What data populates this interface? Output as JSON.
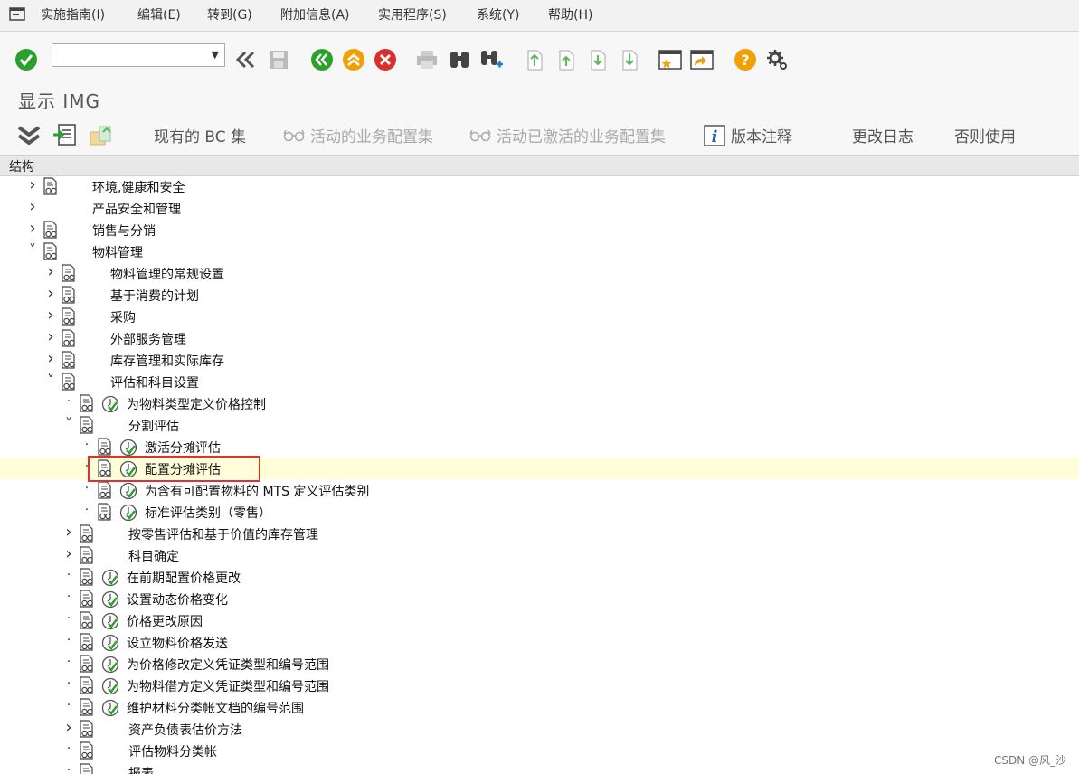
{
  "menu": {
    "items": [
      "实施指南(I)",
      "编辑(E)",
      "转到(G)",
      "附加信息(A)",
      "实用程序(S)",
      "系统(Y)",
      "帮助(H)"
    ]
  },
  "toolbar": {
    "command_field_value": "",
    "icons": [
      "check-icon",
      "back-double-icon",
      "save-icon",
      "back-icon",
      "exit-icon",
      "cancel-icon",
      "print-icon",
      "find-icon",
      "find-next-icon",
      "first-page-icon",
      "prev-page-icon",
      "next-page-icon",
      "last-page-icon",
      "new-session-icon",
      "shortcut-icon",
      "help-icon",
      "settings-icon"
    ]
  },
  "title": "显示 IMG",
  "app_toolbar": {
    "buttons": [
      {
        "label": "现有的 BC 集",
        "enabled": true
      },
      {
        "label": "活动的业务配置集",
        "enabled": false
      },
      {
        "label": "活动已激活的业务配置集",
        "enabled": false
      },
      {
        "label": "版本注释",
        "enabled": true
      },
      {
        "label": "更改日志",
        "enabled": true
      },
      {
        "label": "否则使用",
        "enabled": true
      }
    ]
  },
  "structure_header": "结构",
  "tree": [
    {
      "label": "环境,健康和安全",
      "level": 0,
      "state": "collapsed",
      "doc": true,
      "clock": false
    },
    {
      "label": "产品安全和管理",
      "level": 0,
      "state": "collapsed",
      "doc": false,
      "clock": false
    },
    {
      "label": "销售与分销",
      "level": 0,
      "state": "collapsed",
      "doc": true,
      "clock": false
    },
    {
      "label": "物料管理",
      "level": 0,
      "state": "expanded",
      "doc": true,
      "clock": false
    },
    {
      "label": "物料管理的常规设置",
      "level": 1,
      "state": "collapsed",
      "doc": true,
      "clock": false
    },
    {
      "label": "基于消费的计划",
      "level": 1,
      "state": "collapsed",
      "doc": true,
      "clock": false
    },
    {
      "label": "采购",
      "level": 1,
      "state": "collapsed",
      "doc": true,
      "clock": false
    },
    {
      "label": "外部服务管理",
      "level": 1,
      "state": "collapsed",
      "doc": true,
      "clock": false
    },
    {
      "label": "库存管理和实际库存",
      "level": 1,
      "state": "collapsed",
      "doc": true,
      "clock": false
    },
    {
      "label": "评估和科目设置",
      "level": 1,
      "state": "expanded",
      "doc": true,
      "clock": false
    },
    {
      "label": "为物料类型定义价格控制",
      "level": 2,
      "state": "leaf",
      "doc": true,
      "clock": true
    },
    {
      "label": "分割评估",
      "level": 2,
      "state": "expanded",
      "doc": true,
      "clock": false
    },
    {
      "label": "激活分摊评估",
      "level": 3,
      "state": "leaf",
      "doc": true,
      "clock": true
    },
    {
      "label": "配置分摊评估",
      "level": 3,
      "state": "leaf",
      "doc": true,
      "clock": true,
      "selected": true
    },
    {
      "label": "为含有可配置物料的 MTS 定义评估类别",
      "level": 3,
      "state": "leaf",
      "doc": true,
      "clock": true
    },
    {
      "label": "标准评估类别（零售）",
      "level": 3,
      "state": "leaf",
      "doc": true,
      "clock": true
    },
    {
      "label": "按零售评估和基于价值的库存管理",
      "level": 2,
      "state": "collapsed",
      "doc": true,
      "clock": false
    },
    {
      "label": "科目确定",
      "level": 2,
      "state": "collapsed",
      "doc": true,
      "clock": false
    },
    {
      "label": "在前期配置价格更改",
      "level": 2,
      "state": "leaf",
      "doc": true,
      "clock": true
    },
    {
      "label": "设置动态价格变化",
      "level": 2,
      "state": "leaf",
      "doc": true,
      "clock": true
    },
    {
      "label": "价格更改原因",
      "level": 2,
      "state": "leaf",
      "doc": true,
      "clock": true
    },
    {
      "label": "设立物料价格发送",
      "level": 2,
      "state": "leaf",
      "doc": true,
      "clock": true
    },
    {
      "label": "为价格修改定义凭证类型和编号范围",
      "level": 2,
      "state": "leaf",
      "doc": true,
      "clock": true
    },
    {
      "label": "为物料借方定义凭证类型和编号范围",
      "level": 2,
      "state": "leaf",
      "doc": true,
      "clock": true
    },
    {
      "label": "维护材料分类帐文档的编号范围",
      "level": 2,
      "state": "leaf",
      "doc": true,
      "clock": true
    },
    {
      "label": "资产负债表估价方法",
      "level": 2,
      "state": "collapsed",
      "doc": true,
      "clock": false
    },
    {
      "label": "评估物料分类帐",
      "level": 2,
      "state": "leaf",
      "doc": true,
      "clock": false
    },
    {
      "label": "报表",
      "level": 2,
      "state": "leaf",
      "doc": true,
      "clock": false
    }
  ],
  "watermark": "CSDN @风_沙",
  "colors": {
    "highlight_row": "#fefed8",
    "selection_box": "#e0312d",
    "ok_green": "#2ca02c",
    "cancel_red": "#d9302c",
    "help_yellow": "#f0a000"
  }
}
